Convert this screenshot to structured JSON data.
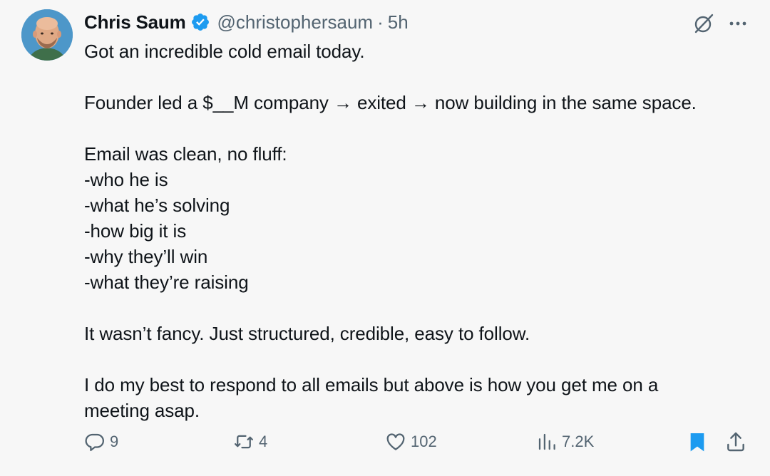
{
  "author": {
    "name": "Chris Saum",
    "handle": "@christophersaum",
    "separator": "·",
    "time": "5h"
  },
  "tweet": {
    "paragraphs": [
      [
        "Got an incredible cold email today."
      ],
      [
        "Founder led a $__M company → exited → now building in the same space."
      ],
      [
        "Email was clean, no fluff:",
        "-who he is",
        "-what he’s solving",
        "-how big it is",
        "-why they’ll win",
        "-what they’re raising"
      ],
      [
        "It wasn’t fancy. Just structured, credible, easy to follow."
      ],
      [
        "I do my best to respond to all emails but above is how you get me on a",
        "meeting asap."
      ]
    ]
  },
  "actions": {
    "replies": "9",
    "reposts": "4",
    "likes": "102",
    "views": "7.2K"
  },
  "icons": {
    "verified": "verified-badge-icon",
    "grok": "grok-icon",
    "more": "more-icon",
    "reply": "reply-icon",
    "repost": "repost-icon",
    "like": "like-icon",
    "views": "views-icon",
    "bookmark": "bookmark-icon",
    "share": "share-icon"
  },
  "colors": {
    "background": "#f7f7f7",
    "text": "#0f1419",
    "secondary": "#536471",
    "accent": "#1d9bf0"
  }
}
